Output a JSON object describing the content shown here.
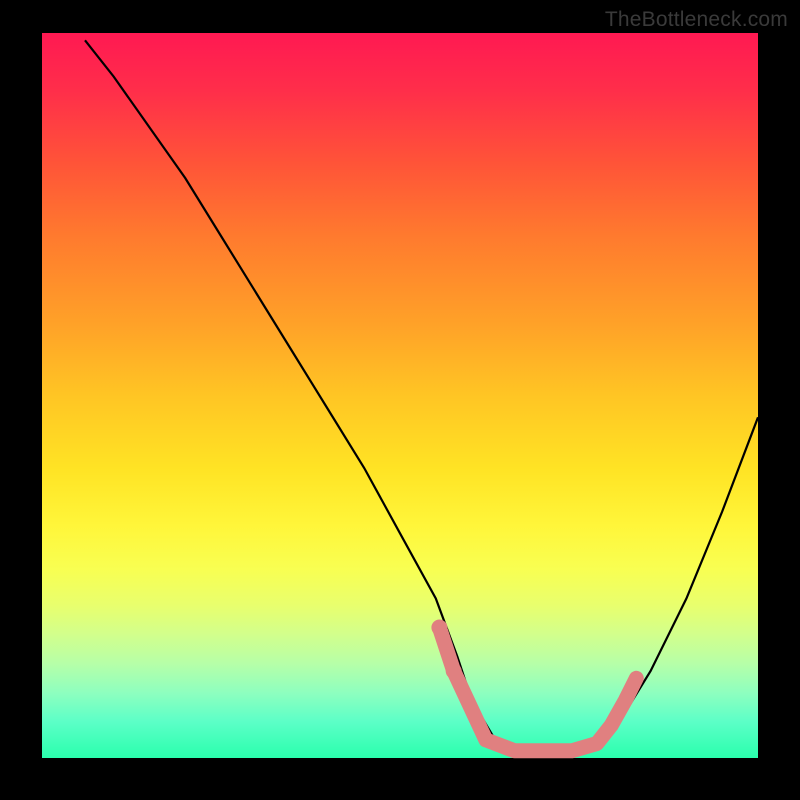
{
  "watermark": "TheBottleneck.com",
  "chart_data": {
    "type": "line",
    "title": "",
    "xlabel": "",
    "ylabel": "",
    "xlim": [
      0,
      100
    ],
    "ylim": [
      0,
      100
    ],
    "series": [
      {
        "name": "bottleneck-curve",
        "x": [
          6,
          10,
          15,
          20,
          25,
          30,
          35,
          40,
          45,
          50,
          55,
          58,
          60,
          63,
          66,
          70,
          75,
          80,
          85,
          90,
          95,
          100
        ],
        "y": [
          99,
          94,
          87,
          80,
          72,
          64,
          56,
          48,
          40,
          31,
          22,
          14,
          8,
          3,
          1,
          1,
          1,
          4,
          12,
          22,
          34,
          47
        ]
      }
    ],
    "markers": {
      "name": "highlight-segment",
      "color": "#e08080",
      "points": [
        {
          "x": 55.5,
          "y": 18
        },
        {
          "x": 57.5,
          "y": 12
        },
        {
          "x": 62.0,
          "y": 2.5
        },
        {
          "x": 66.0,
          "y": 1
        },
        {
          "x": 70.0,
          "y": 1
        },
        {
          "x": 74.0,
          "y": 1
        },
        {
          "x": 77.5,
          "y": 2
        },
        {
          "x": 79.5,
          "y": 4.5
        },
        {
          "x": 81.5,
          "y": 8
        },
        {
          "x": 83.0,
          "y": 11
        }
      ]
    },
    "gradient_stops": [
      {
        "pos": 0,
        "color": "#ff1952"
      },
      {
        "pos": 50,
        "color": "#ffc524"
      },
      {
        "pos": 75,
        "color": "#f8ff52"
      },
      {
        "pos": 100,
        "color": "#2affad"
      }
    ]
  }
}
